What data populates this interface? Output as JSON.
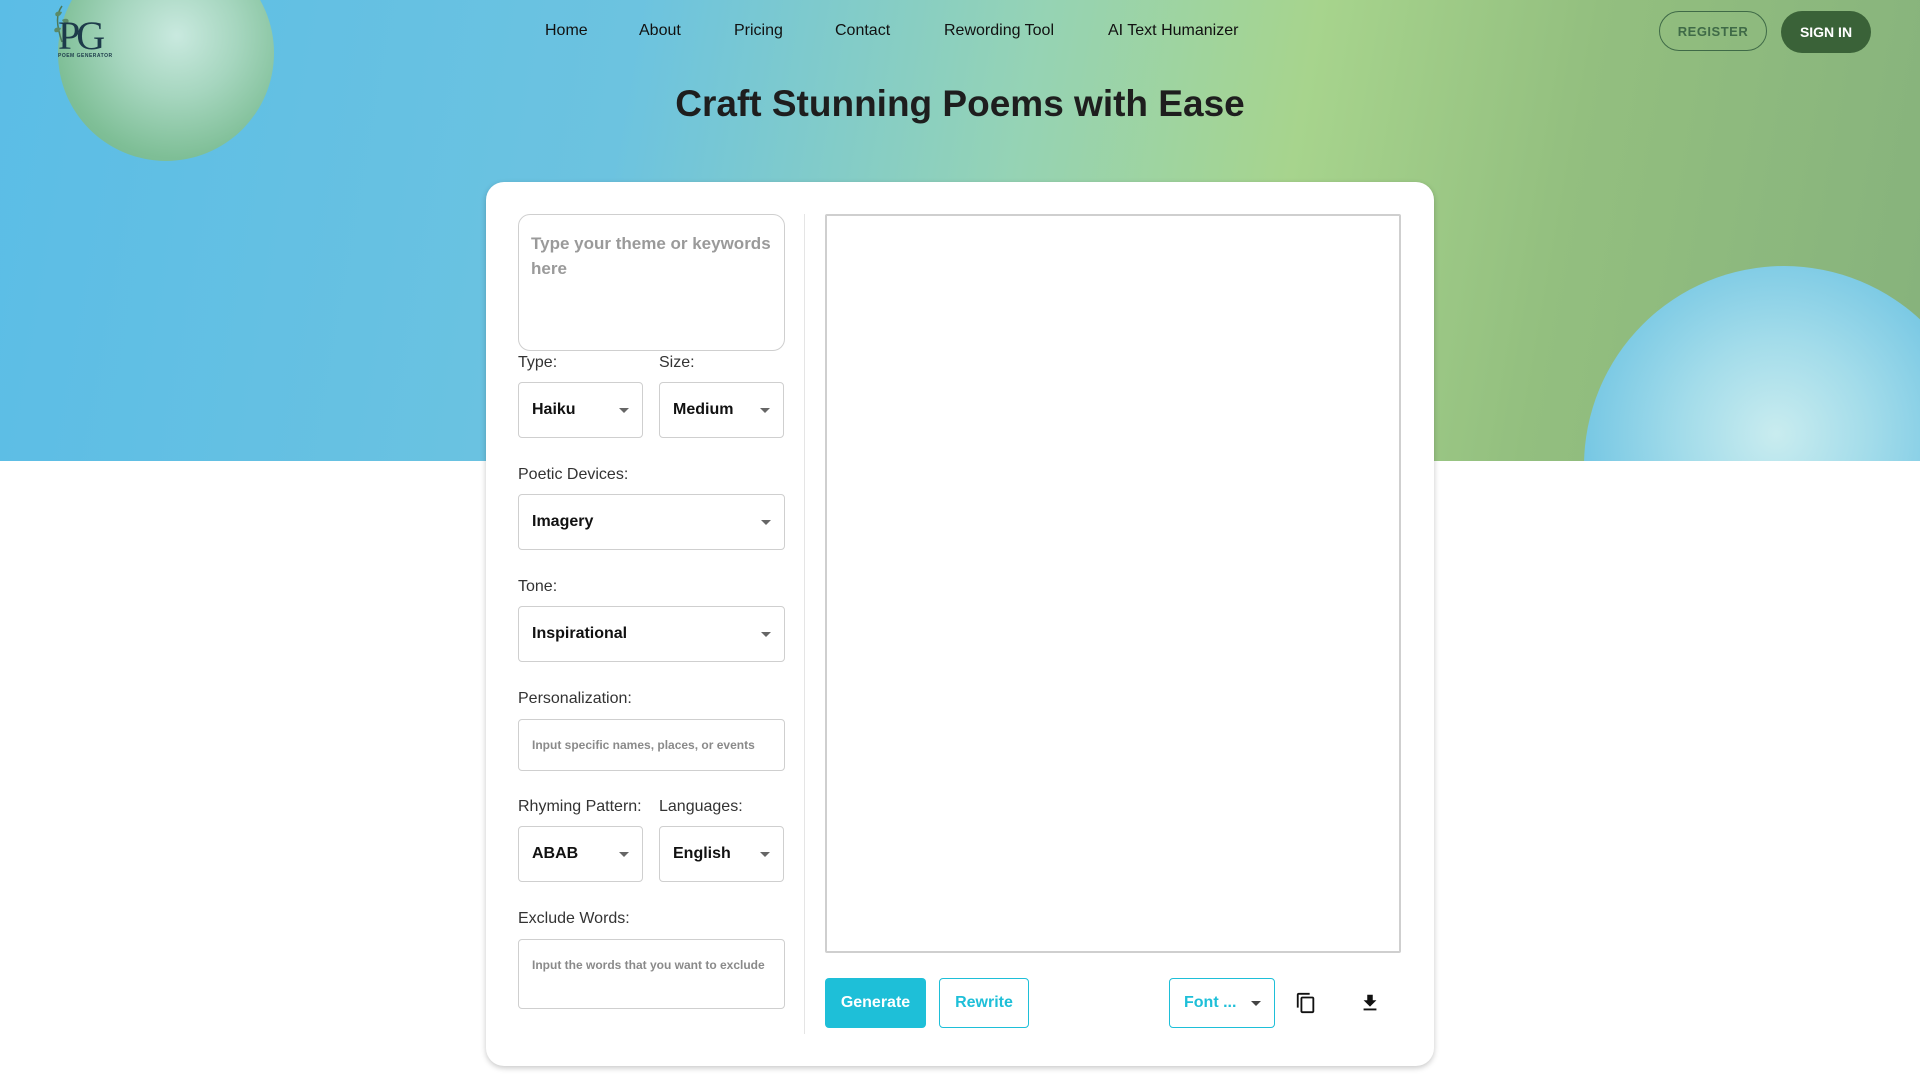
{
  "brand": {
    "logo_text": "PG",
    "logo_subtitle": "POEM GENERATOR"
  },
  "nav": {
    "items": [
      "Home",
      "About",
      "Pricing",
      "Contact",
      "Rewording Tool",
      "AI Text Humanizer"
    ],
    "register_label": "REGISTER",
    "signin_label": "SIGN IN"
  },
  "hero": {
    "title": "Craft Stunning Poems with Ease"
  },
  "form": {
    "theme_placeholder": "Type your theme or keywords here",
    "type_label": "Type:",
    "type_value": "Haiku",
    "size_label": "Size:",
    "size_value": "Medium",
    "devices_label": "Poetic Devices:",
    "devices_value": "Imagery",
    "tone_label": "Tone:",
    "tone_value": "Inspirational",
    "personalization_label": "Personalization:",
    "personalization_placeholder": "Input specific names, places, or events",
    "rhyme_label": "Rhyming Pattern:",
    "rhyme_value": "ABAB",
    "languages_label": "Languages:",
    "languages_value": "English",
    "exclude_label": "Exclude Words:",
    "exclude_placeholder": "Input the words that you want to exclude"
  },
  "output": {
    "generate_label": "Generate",
    "rewrite_label": "Rewrite",
    "font_value": "Font ...",
    "copy_icon": "copy-icon",
    "download_icon": "download-icon"
  },
  "colors": {
    "accent": "#1ebfd8",
    "signin_bg": "#3a6238",
    "register_border": "#3f6a47"
  }
}
